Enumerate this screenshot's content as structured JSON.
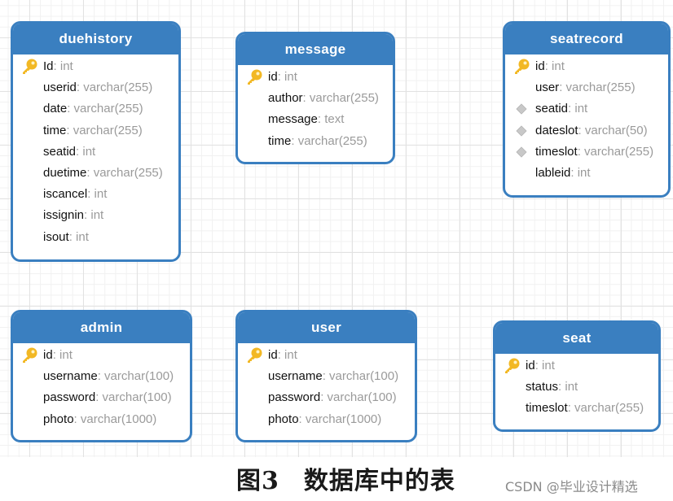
{
  "colors": {
    "entity_header": "#3a7fc0",
    "entity_border": "#3a7fc0",
    "field_name": "#111111",
    "field_type": "#9a9a9a",
    "primary_key_icon": "#f2b824",
    "foreign_key_icon": "#c8c8c8"
  },
  "tables": [
    {
      "name": "duehistory",
      "fields": [
        {
          "name": "Id",
          "type": "int",
          "icon": "key-icon"
        },
        {
          "name": "userid",
          "type": "varchar(255)",
          "icon": ""
        },
        {
          "name": "date",
          "type": "varchar(255)",
          "icon": ""
        },
        {
          "name": "time",
          "type": "varchar(255)",
          "icon": ""
        },
        {
          "name": "seatid",
          "type": "int",
          "icon": ""
        },
        {
          "name": "duetime",
          "type": "varchar(255)",
          "icon": ""
        },
        {
          "name": "iscancel",
          "type": "int",
          "icon": ""
        },
        {
          "name": "issignin",
          "type": "int",
          "icon": ""
        },
        {
          "name": "isout",
          "type": "int",
          "icon": ""
        }
      ]
    },
    {
      "name": "message",
      "fields": [
        {
          "name": "id",
          "type": "int",
          "icon": "key-icon"
        },
        {
          "name": "author",
          "type": "varchar(255)",
          "icon": ""
        },
        {
          "name": "message",
          "type": "text",
          "icon": ""
        },
        {
          "name": "time",
          "type": "varchar(255)",
          "icon": ""
        }
      ]
    },
    {
      "name": "seatrecord",
      "fields": [
        {
          "name": "id",
          "type": "int",
          "icon": "key-icon"
        },
        {
          "name": "user",
          "type": "varchar(255)",
          "icon": ""
        },
        {
          "name": "seatid",
          "type": "int",
          "icon": "diamond-icon"
        },
        {
          "name": "dateslot",
          "type": "varchar(50)",
          "icon": "diamond-icon"
        },
        {
          "name": "timeslot",
          "type": "varchar(255)",
          "icon": "diamond-icon"
        },
        {
          "name": "lableid",
          "type": "int",
          "icon": ""
        }
      ]
    },
    {
      "name": "admin",
      "fields": [
        {
          "name": "id",
          "type": "int",
          "icon": "key-icon"
        },
        {
          "name": "username",
          "type": "varchar(100)",
          "icon": ""
        },
        {
          "name": "password",
          "type": "varchar(100)",
          "icon": ""
        },
        {
          "name": "photo",
          "type": "varchar(1000)",
          "icon": ""
        }
      ]
    },
    {
      "name": "user",
      "fields": [
        {
          "name": "id",
          "type": "int",
          "icon": "key-icon"
        },
        {
          "name": "username",
          "type": "varchar(100)",
          "icon": ""
        },
        {
          "name": "password",
          "type": "varchar(100)",
          "icon": ""
        },
        {
          "name": "photo",
          "type": "varchar(1000)",
          "icon": ""
        }
      ]
    },
    {
      "name": "seat",
      "fields": [
        {
          "name": "id",
          "type": "int",
          "icon": "key-icon"
        },
        {
          "name": "status",
          "type": "int",
          "icon": ""
        },
        {
          "name": "timeslot",
          "type": "varchar(255)",
          "icon": ""
        }
      ]
    }
  ],
  "separator": ": ",
  "caption": {
    "figure": "图3",
    "title": "数据库中的表"
  },
  "watermark": "CSDN @毕业设计精选"
}
